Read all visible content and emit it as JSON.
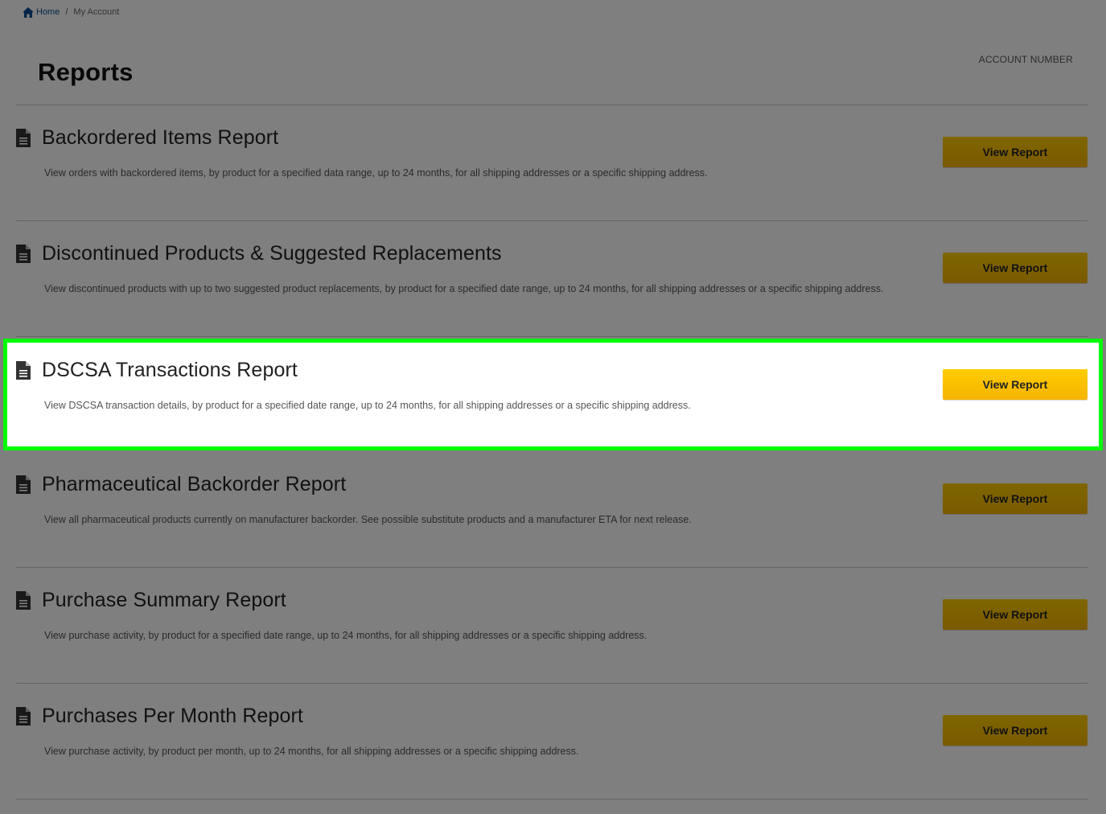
{
  "breadcrumb": {
    "home_label": "Home",
    "separator": "/",
    "current_label": "My Account"
  },
  "header": {
    "title": "Reports",
    "account_number_label": "ACCOUNT NUMBER"
  },
  "reports": [
    {
      "title": "Backordered Items Report",
      "description": "View orders with backordered items, by product for a specified data range, up to 24 months, for all shipping addresses or a specific shipping address.",
      "button_label": "View Report"
    },
    {
      "title": "Discontinued Products & Suggested Replacements",
      "description": "View discontinued products with up to two suggested product replacements, by product for a specified date range, up to 24 months, for all shipping addresses or a specific shipping address.",
      "button_label": "View Report"
    },
    {
      "title": "DSCSA Transactions Report",
      "description": "View DSCSA transaction details, by product for a specified date range, up to 24 months, for all shipping addresses or a specific shipping address.",
      "button_label": "View Report"
    },
    {
      "title": "Pharmaceutical Backorder Report",
      "description": "View all pharmaceutical products currently on manufacturer backorder. See possible substitute products and a manufacturer ETA for next release.",
      "button_label": "View Report"
    },
    {
      "title": "Purchase Summary Report",
      "description": "View purchase activity, by product for a specified date range, up to 24 months, for all shipping addresses or a specific shipping address.",
      "button_label": "View Report"
    },
    {
      "title": "Purchases Per Month Report",
      "description": "View purchase activity, by product per month, up to 24 months, for all shipping addresses or a specific shipping address.",
      "button_label": "View Report"
    }
  ],
  "icons": {
    "home": "home-icon",
    "report": "document-icon"
  },
  "colors": {
    "button": "#ffcc00",
    "highlight_border": "#00ff00",
    "link": "#0b4a8f",
    "overlay": "#000000"
  }
}
